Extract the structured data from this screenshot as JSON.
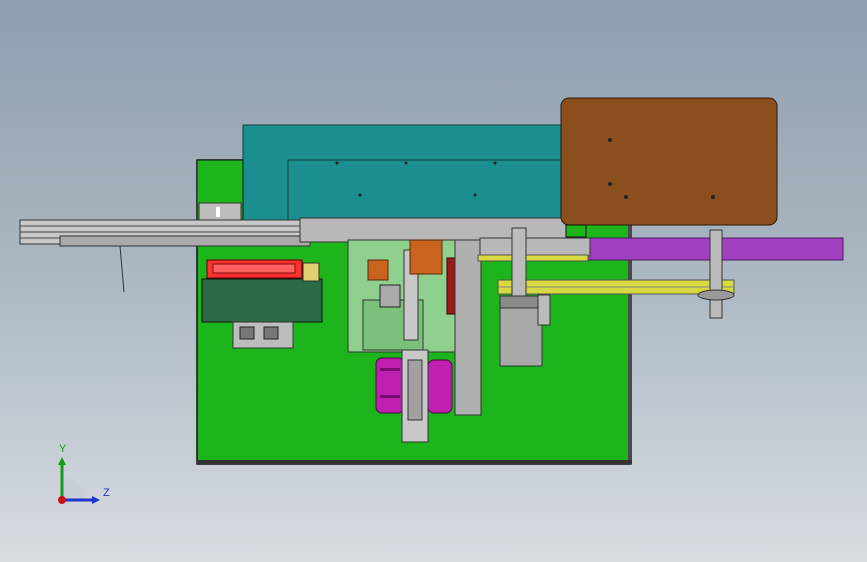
{
  "viewport": {
    "background_top": "#8f9fae",
    "background_bottom": "#d7dce1"
  },
  "model": {
    "colors": {
      "base_plate": "#1cb51c",
      "teal_cover": "#1b8f8f",
      "brown_panel": "#8b4f1e",
      "purple_arm": "#a040c0",
      "magenta_roller": "#c020b0",
      "red_block": "#ff3030",
      "dark_green_block": "#2a6a45",
      "maroon_motor": "#9a1a1a",
      "light_green_frame": "#8fd08f",
      "steel": "#c4c4c4",
      "yellow_belt": "#d8d840"
    }
  },
  "triad": {
    "y_label": "Y",
    "z_label": "Z",
    "y_icon": "axis-y-arrow",
    "z_icon": "axis-z-arrow",
    "origin_icon": "axis-origin-dot"
  }
}
